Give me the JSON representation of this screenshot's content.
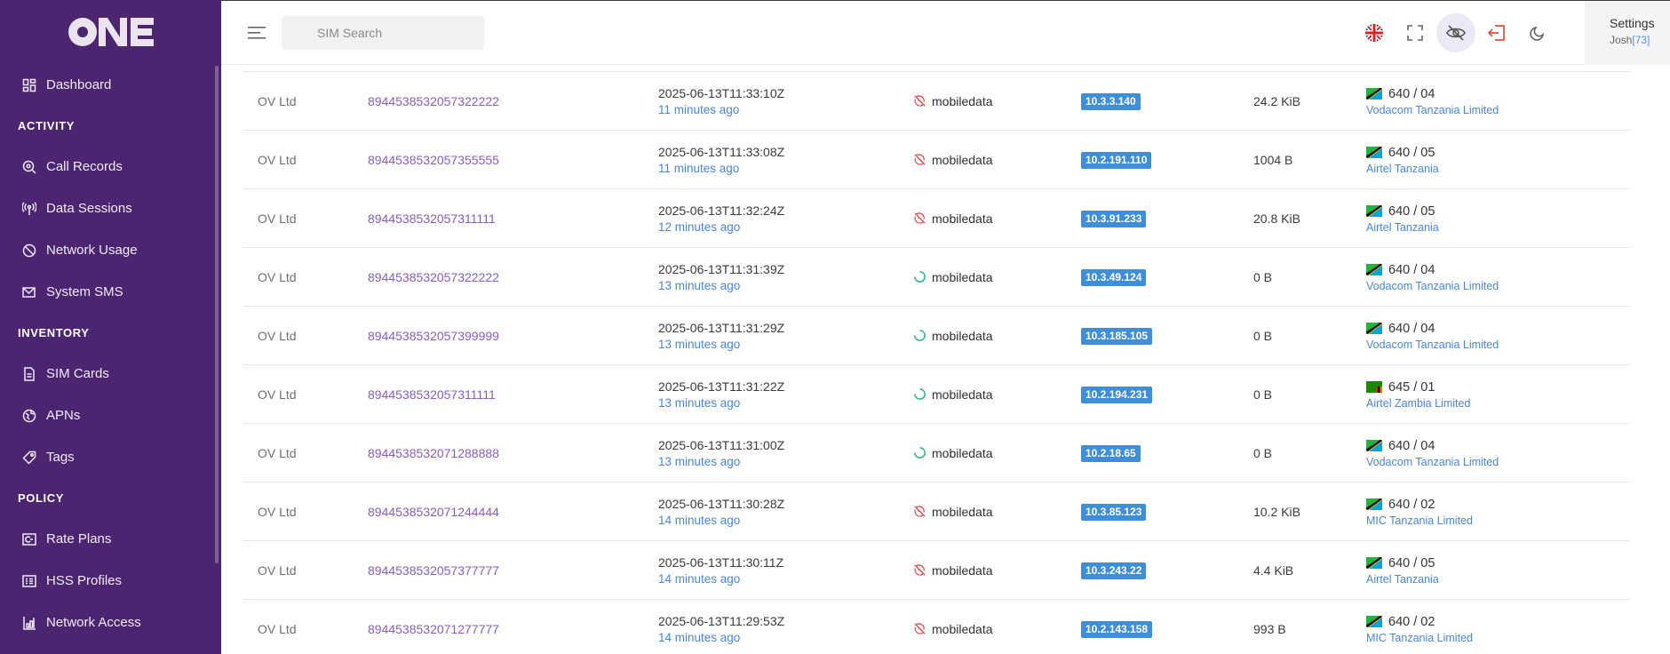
{
  "sidebar": {
    "logo_text": "ONE",
    "items": [
      {
        "type": "item",
        "label": "Dashboard",
        "icon": "dashboard-icon"
      },
      {
        "type": "section",
        "label": "ACTIVITY"
      },
      {
        "type": "item",
        "label": "Call Records",
        "icon": "search-phone-icon"
      },
      {
        "type": "item",
        "label": "Data Sessions",
        "icon": "antenna-icon"
      },
      {
        "type": "item",
        "label": "Network Usage",
        "icon": "network-usage-icon"
      },
      {
        "type": "item",
        "label": "System SMS",
        "icon": "sms-icon"
      },
      {
        "type": "section",
        "label": "INVENTORY"
      },
      {
        "type": "item",
        "label": "SIM Cards",
        "icon": "sim-card-icon"
      },
      {
        "type": "item",
        "label": "APNs",
        "icon": "globe-icon"
      },
      {
        "type": "item",
        "label": "Tags",
        "icon": "tag-icon"
      },
      {
        "type": "section",
        "label": "POLICY"
      },
      {
        "type": "item",
        "label": "Rate Plans",
        "icon": "rate-plan-icon"
      },
      {
        "type": "item",
        "label": "HSS Profiles",
        "icon": "profile-list-icon"
      },
      {
        "type": "item",
        "label": "Network Access",
        "icon": "network-access-icon"
      }
    ]
  },
  "topbar": {
    "search_placeholder": "SIM Search",
    "icons": [
      "uk-flag-icon",
      "fullscreen-icon",
      "eye-off-icon",
      "logout-icon",
      "moon-icon"
    ],
    "settings_label": "Settings",
    "user_name": "Josh",
    "user_id": "[73]"
  },
  "colors": {
    "sidebar_bg": "#4b2570",
    "link_purple": "#8a5cc2",
    "link_blue": "#4a86d8",
    "ip_badge": "#3f8ed8",
    "status_red": "#e05050",
    "status_green": "#2bb38a"
  },
  "rows": [
    {
      "org": "OV Ltd",
      "iccid": "8944538532057322222",
      "timestamp": "2025-06-13T11:33:10Z",
      "ago": "11 minutes ago",
      "status": "ended",
      "apn": "mobiledata",
      "ip": "10.3.3.140",
      "bytes": "24.2 KiB",
      "flag": "tz",
      "mccmnc": "640 / 04",
      "operator": "Vodacom Tanzania Limited"
    },
    {
      "org": "OV Ltd",
      "iccid": "8944538532057355555",
      "timestamp": "2025-06-13T11:33:08Z",
      "ago": "11 minutes ago",
      "status": "ended",
      "apn": "mobiledata",
      "ip": "10.2.191.110",
      "bytes": "1004 B",
      "flag": "tz",
      "mccmnc": "640 / 05",
      "operator": "Airtel Tanzania"
    },
    {
      "org": "OV Ltd",
      "iccid": "8944538532057311111",
      "timestamp": "2025-06-13T11:32:24Z",
      "ago": "12 minutes ago",
      "status": "ended",
      "apn": "mobiledata",
      "ip": "10.3.91.233",
      "bytes": "20.8 KiB",
      "flag": "tz",
      "mccmnc": "640 / 05",
      "operator": "Airtel Tanzania"
    },
    {
      "org": "OV Ltd",
      "iccid": "8944538532057322222",
      "timestamp": "2025-06-13T11:31:39Z",
      "ago": "13 minutes ago",
      "status": "active",
      "apn": "mobiledata",
      "ip": "10.3.49.124",
      "bytes": "0 B",
      "flag": "tz",
      "mccmnc": "640 / 04",
      "operator": "Vodacom Tanzania Limited"
    },
    {
      "org": "OV Ltd",
      "iccid": "8944538532057399999",
      "timestamp": "2025-06-13T11:31:29Z",
      "ago": "13 minutes ago",
      "status": "active",
      "apn": "mobiledata",
      "ip": "10.3.185.105",
      "bytes": "0 B",
      "flag": "tz",
      "mccmnc": "640 / 04",
      "operator": "Vodacom Tanzania Limited"
    },
    {
      "org": "OV Ltd",
      "iccid": "8944538532057311111",
      "timestamp": "2025-06-13T11:31:22Z",
      "ago": "13 minutes ago",
      "status": "active",
      "apn": "mobiledata",
      "ip": "10.2.194.231",
      "bytes": "0 B",
      "flag": "zm",
      "mccmnc": "645 / 01",
      "operator": "Airtel Zambia Limited"
    },
    {
      "org": "OV Ltd",
      "iccid": "8944538532071288888",
      "timestamp": "2025-06-13T11:31:00Z",
      "ago": "13 minutes ago",
      "status": "active",
      "apn": "mobiledata",
      "ip": "10.2.18.65",
      "bytes": "0 B",
      "flag": "tz",
      "mccmnc": "640 / 04",
      "operator": "Vodacom Tanzania Limited"
    },
    {
      "org": "OV Ltd",
      "iccid": "8944538532071244444",
      "timestamp": "2025-06-13T11:30:28Z",
      "ago": "14 minutes ago",
      "status": "ended",
      "apn": "mobiledata",
      "ip": "10.3.85.123",
      "bytes": "10.2 KiB",
      "flag": "tz",
      "mccmnc": "640 / 02",
      "operator": "MIC Tanzania Limited"
    },
    {
      "org": "OV Ltd",
      "iccid": "8944538532057377777",
      "timestamp": "2025-06-13T11:30:11Z",
      "ago": "14 minutes ago",
      "status": "ended",
      "apn": "mobiledata",
      "ip": "10.3.243.22",
      "bytes": "4.4 KiB",
      "flag": "tz",
      "mccmnc": "640 / 05",
      "operator": "Airtel Tanzania"
    },
    {
      "org": "OV Ltd",
      "iccid": "8944538532071277777",
      "timestamp": "2025-06-13T11:29:53Z",
      "ago": "14 minutes ago",
      "status": "ended",
      "apn": "mobiledata",
      "ip": "10.2.143.158",
      "bytes": "993 B",
      "flag": "tz",
      "mccmnc": "640 / 02",
      "operator": "MIC Tanzania Limited"
    }
  ]
}
